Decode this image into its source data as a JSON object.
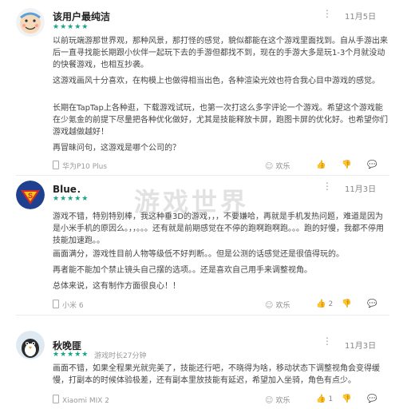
{
  "reviews": [
    {
      "name": "该用户最纯洁",
      "stars": "★★★★★",
      "date": "11月5日",
      "paragraphs": [
        "以前玩端游那世界观，那种风景，那打怪的感觉，貌似都能在这个游戏里面找到。自从手游出来后一直寻找能长期跟小伙伴一起玩下去的手游但都找不到，现在的手游大多是玩1-3个月就没动的快餐游戏，也相互抄袭。",
        "这游戏画风十分喜欢，在构模上也做得相当出色，各种渲染光效也符合我心目中游戏的感觉。",
        "长期在TapTap上各种逛，下载游戏试玩，也第一次打这么多字评论一个游戏。希望这个游戏能在少氪金的前提下尽量把各种优化做好，尤其是技能释放卡屏，跑图卡屏的优化好。也希望你们游戏越做越好！",
        "再冒昧问句，这游戏是哪个公司的？"
      ],
      "device": "华为P10 Plus",
      "actions": {
        "happy": "欢乐",
        "likes": "",
        "dislikes": "",
        "comments": ""
      }
    },
    {
      "name": "Blue．",
      "stars": "★★★★★",
      "date": "11月3日",
      "paragraphs": [
        "游戏不错，特别特别棒，我这种垂3D的游戏，，，不要嫌哈，再就是手机发热问题，难道是因为是小米手机的原因么。，，。。。还有就是前期感觉在不停的跑啊跑啊跑。。。跑的好慢，我都不停用技能加速跑。。",
        "画面满分，游戏性目前人物等级低不好判断。。但是公测的话感觉还是很值得玩的。",
        "再者能不能加个禁止镜头自己摆的选项。。还是喜欢自己用手来调整视角。",
        "总体来说，这有制作方面很良心！！"
      ],
      "device": "小米 6",
      "actions": {
        "happy": "欢乐",
        "likes": "2",
        "dislikes": "",
        "comments": ""
      }
    },
    {
      "name": "秋晚匪",
      "stars": "★★★★★",
      "meta": "游戏时长27分钟",
      "date": "11月3日",
      "paragraphs": [
        "画面不错，如果全程果光就完美了，技能还行吧，不晓得为啥，移动状态下调整视角会变得缓慢，打副本的时候体验极差，还有副本里放技能有延迟，希望加入坐骑，角色有点少。"
      ],
      "device": "Xiaomi MIX 2",
      "actions": {
        "happy": "欢乐",
        "likes": "1",
        "dislikes": "",
        "comments": ""
      }
    }
  ],
  "icons": {
    "more": "more-vertical-icon",
    "happy": "smiley-icon",
    "like": "thumbs-up-icon",
    "dislike": "thumbs-down-icon",
    "comment": "comment-icon"
  },
  "colors": {
    "accent": "#15a589",
    "watermark": "#bebebe"
  },
  "watermark": "游戏世界"
}
